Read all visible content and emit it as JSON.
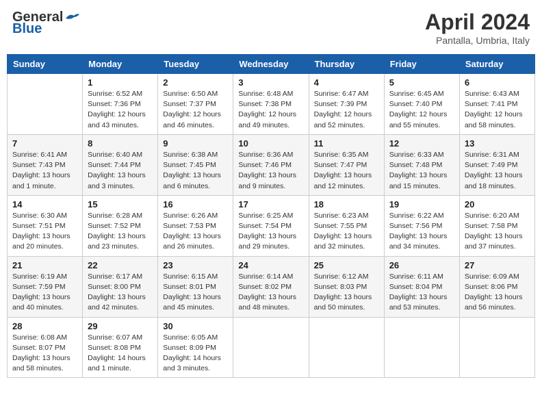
{
  "header": {
    "logo": {
      "general": "General",
      "blue": "Blue"
    },
    "title": "April 2024",
    "subtitle": "Pantalla, Umbria, Italy"
  },
  "calendar": {
    "weekdays": [
      "Sunday",
      "Monday",
      "Tuesday",
      "Wednesday",
      "Thursday",
      "Friday",
      "Saturday"
    ],
    "weeks": [
      [
        {
          "day": "",
          "info": ""
        },
        {
          "day": "1",
          "info": "Sunrise: 6:52 AM\nSunset: 7:36 PM\nDaylight: 12 hours\nand 43 minutes."
        },
        {
          "day": "2",
          "info": "Sunrise: 6:50 AM\nSunset: 7:37 PM\nDaylight: 12 hours\nand 46 minutes."
        },
        {
          "day": "3",
          "info": "Sunrise: 6:48 AM\nSunset: 7:38 PM\nDaylight: 12 hours\nand 49 minutes."
        },
        {
          "day": "4",
          "info": "Sunrise: 6:47 AM\nSunset: 7:39 PM\nDaylight: 12 hours\nand 52 minutes."
        },
        {
          "day": "5",
          "info": "Sunrise: 6:45 AM\nSunset: 7:40 PM\nDaylight: 12 hours\nand 55 minutes."
        },
        {
          "day": "6",
          "info": "Sunrise: 6:43 AM\nSunset: 7:41 PM\nDaylight: 12 hours\nand 58 minutes."
        }
      ],
      [
        {
          "day": "7",
          "info": "Sunrise: 6:41 AM\nSunset: 7:43 PM\nDaylight: 13 hours\nand 1 minute."
        },
        {
          "day": "8",
          "info": "Sunrise: 6:40 AM\nSunset: 7:44 PM\nDaylight: 13 hours\nand 3 minutes."
        },
        {
          "day": "9",
          "info": "Sunrise: 6:38 AM\nSunset: 7:45 PM\nDaylight: 13 hours\nand 6 minutes."
        },
        {
          "day": "10",
          "info": "Sunrise: 6:36 AM\nSunset: 7:46 PM\nDaylight: 13 hours\nand 9 minutes."
        },
        {
          "day": "11",
          "info": "Sunrise: 6:35 AM\nSunset: 7:47 PM\nDaylight: 13 hours\nand 12 minutes."
        },
        {
          "day": "12",
          "info": "Sunrise: 6:33 AM\nSunset: 7:48 PM\nDaylight: 13 hours\nand 15 minutes."
        },
        {
          "day": "13",
          "info": "Sunrise: 6:31 AM\nSunset: 7:49 PM\nDaylight: 13 hours\nand 18 minutes."
        }
      ],
      [
        {
          "day": "14",
          "info": "Sunrise: 6:30 AM\nSunset: 7:51 PM\nDaylight: 13 hours\nand 20 minutes."
        },
        {
          "day": "15",
          "info": "Sunrise: 6:28 AM\nSunset: 7:52 PM\nDaylight: 13 hours\nand 23 minutes."
        },
        {
          "day": "16",
          "info": "Sunrise: 6:26 AM\nSunset: 7:53 PM\nDaylight: 13 hours\nand 26 minutes."
        },
        {
          "day": "17",
          "info": "Sunrise: 6:25 AM\nSunset: 7:54 PM\nDaylight: 13 hours\nand 29 minutes."
        },
        {
          "day": "18",
          "info": "Sunrise: 6:23 AM\nSunset: 7:55 PM\nDaylight: 13 hours\nand 32 minutes."
        },
        {
          "day": "19",
          "info": "Sunrise: 6:22 AM\nSunset: 7:56 PM\nDaylight: 13 hours\nand 34 minutes."
        },
        {
          "day": "20",
          "info": "Sunrise: 6:20 AM\nSunset: 7:58 PM\nDaylight: 13 hours\nand 37 minutes."
        }
      ],
      [
        {
          "day": "21",
          "info": "Sunrise: 6:19 AM\nSunset: 7:59 PM\nDaylight: 13 hours\nand 40 minutes."
        },
        {
          "day": "22",
          "info": "Sunrise: 6:17 AM\nSunset: 8:00 PM\nDaylight: 13 hours\nand 42 minutes."
        },
        {
          "day": "23",
          "info": "Sunrise: 6:15 AM\nSunset: 8:01 PM\nDaylight: 13 hours\nand 45 minutes."
        },
        {
          "day": "24",
          "info": "Sunrise: 6:14 AM\nSunset: 8:02 PM\nDaylight: 13 hours\nand 48 minutes."
        },
        {
          "day": "25",
          "info": "Sunrise: 6:12 AM\nSunset: 8:03 PM\nDaylight: 13 hours\nand 50 minutes."
        },
        {
          "day": "26",
          "info": "Sunrise: 6:11 AM\nSunset: 8:04 PM\nDaylight: 13 hours\nand 53 minutes."
        },
        {
          "day": "27",
          "info": "Sunrise: 6:09 AM\nSunset: 8:06 PM\nDaylight: 13 hours\nand 56 minutes."
        }
      ],
      [
        {
          "day": "28",
          "info": "Sunrise: 6:08 AM\nSunset: 8:07 PM\nDaylight: 13 hours\nand 58 minutes."
        },
        {
          "day": "29",
          "info": "Sunrise: 6:07 AM\nSunset: 8:08 PM\nDaylight: 14 hours\nand 1 minute."
        },
        {
          "day": "30",
          "info": "Sunrise: 6:05 AM\nSunset: 8:09 PM\nDaylight: 14 hours\nand 3 minutes."
        },
        {
          "day": "",
          "info": ""
        },
        {
          "day": "",
          "info": ""
        },
        {
          "day": "",
          "info": ""
        },
        {
          "day": "",
          "info": ""
        }
      ]
    ]
  }
}
